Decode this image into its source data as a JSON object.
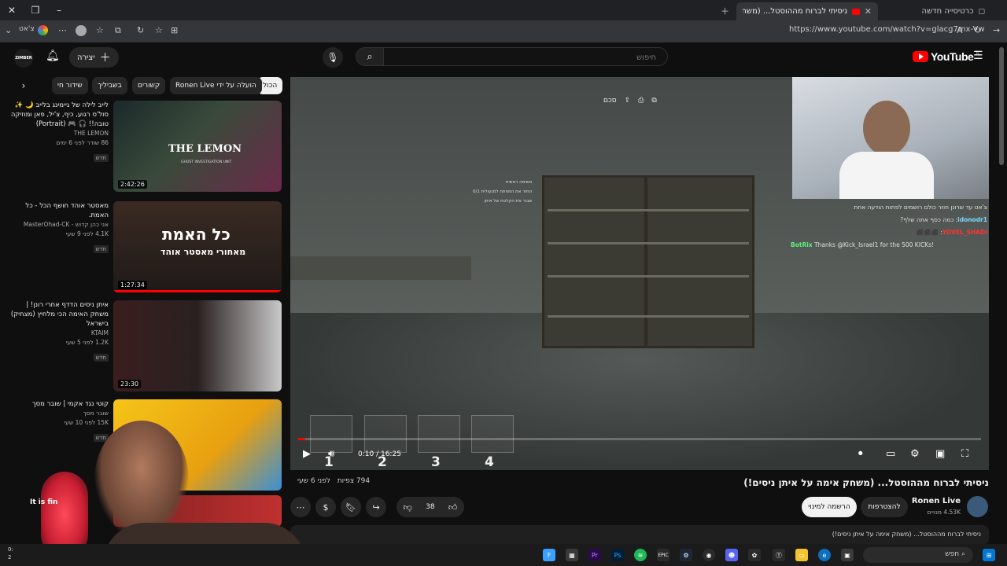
{
  "browser": {
    "tabs": [
      {
        "label": "ניסיתי לברוח מההוסטל... (משחק א",
        "active": true
      },
      {
        "label": "כרטיסייה חדשה",
        "active": false
      }
    ],
    "url": "https://www.youtube.com/watch?v=glacg7mx-Vw",
    "profile_label": "צ'אט"
  },
  "header": {
    "logo_text": "YouTube",
    "logo_region": "IL",
    "search_placeholder": "חיפוש",
    "create_label": "יצירה",
    "account_label": "ZIMBER"
  },
  "chips": [
    "הכול",
    "הועלה על ידי Ronen Live",
    "קשורים",
    "בשביליך",
    "שידור חי"
  ],
  "recommended": [
    {
      "title": "לייב לילה של גיימינג בלייב 🌙 ✨ סול'ס רגוע, כיף, צ'יל, פאן ומוזיקה טובה!! 🎧 🎮 (Portrait)",
      "channel": "THE LEMON",
      "stats": "86 שודר לפני 6 ימים",
      "badge": "חדש",
      "duration": "2:42:26",
      "thumb_text": "THE LEMON",
      "thumb_sub": "GHOST INVESTIGATION UNIT"
    },
    {
      "title": "מאסטר אוהד חושף הכל - כל האמת.",
      "channel": "אני כהן קדוש - MasterOhad-CK",
      "stats": "4.1K לפני 9 שעי",
      "badge": "חדש",
      "duration": "1:27:34",
      "thumb_text": "כל האמת",
      "thumb_sub": "מאחורי מאסטר אוהד"
    },
    {
      "title": "איתן ניסים הדדף אחרי רונן! | משחק האימה הכי מלחיץ (מצחיק) בישראל",
      "channel": "KTAIM",
      "stats": "1.2K לפני 5 שעי",
      "badge": "חדש",
      "duration": "23:30"
    },
    {
      "title": "קוטי נגד אקמי | שובר מסך",
      "channel": "שובר מסך",
      "stats": "15K לפני 10 שעי",
      "badge": "חדש",
      "duration": ""
    }
  ],
  "player": {
    "time_current": "0:10",
    "time_total": "16:25",
    "progress_fraction": 0.01,
    "top_controls": [
      "סכם"
    ],
    "storyboard_numbers": [
      "1",
      "2",
      "3",
      "4"
    ],
    "game_note": [
      "משימה ראשית",
      "החזר את המפתח למנעולית 0/1",
      "שבור את הקלטת של איתן"
    ],
    "chat": [
      {
        "user": "",
        "text": "צ'אט עד שרונן חוזר כולם רושמים לפתות הודעה אחת"
      },
      {
        "user": "idonodr1",
        "text": "כמה כסף אתה שלף?"
      },
      {
        "user": "YOVEL_SHADI",
        "text": "⬛⬛⬛"
      },
      {
        "user": "BotRix",
        "text": "Thanks @Kick_Israel1 for the 500 KICKs!"
      }
    ]
  },
  "video": {
    "title": "ניסיתי לברוח מההוסטל... (משחק אימה על איתן ניסים!)",
    "views": "794 צפיות",
    "age": "לפני 6 שעי",
    "likes": "38",
    "channel_name": "Ronen Live",
    "subscribers": "4.53K מנויים",
    "join_label": "להצטרפות",
    "subscribe_label": "הרשמה למינוי",
    "description_preview": "ניסיתי לברוח מההוסטל... (משחק אימה על איתן ניסים!)"
  },
  "overlay_text": "It is fin",
  "taskbar": {
    "search_label": "חפש",
    "clock_lines": [
      "0:",
      "2"
    ]
  }
}
